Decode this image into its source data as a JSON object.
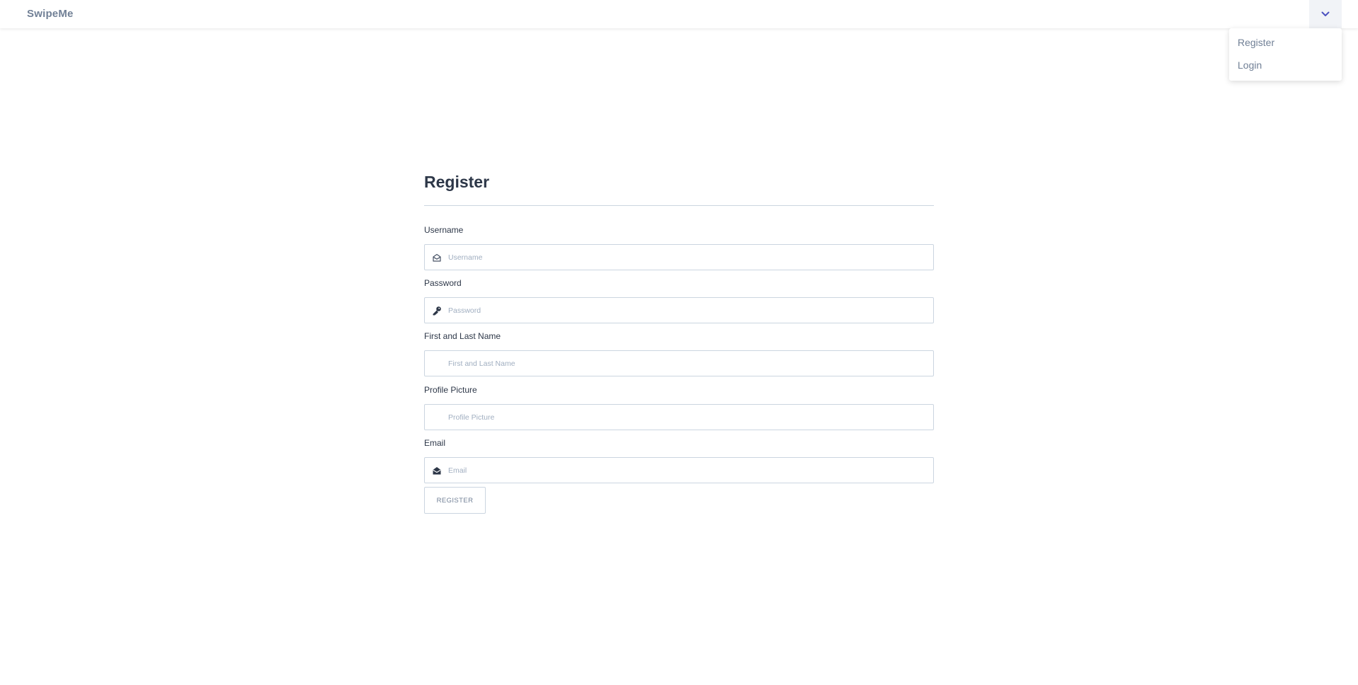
{
  "navbar": {
    "brand": "SwipeMe",
    "menu_items": [
      {
        "label": "Register"
      },
      {
        "label": "Login"
      }
    ]
  },
  "form": {
    "title": "Register",
    "fields": [
      {
        "label": "Username",
        "placeholder": "Username",
        "value": "",
        "icon": "envelope-open-icon"
      },
      {
        "label": "Password",
        "placeholder": "Password",
        "value": "",
        "icon": "key-icon"
      },
      {
        "label": "First and Last Name",
        "placeholder": "First and Last Name",
        "value": "",
        "icon": ""
      },
      {
        "label": "Profile Picture",
        "placeholder": "Profile Picture",
        "value": "",
        "icon": ""
      },
      {
        "label": "Email",
        "placeholder": "Email",
        "value": "",
        "icon": "envelope-solid-icon"
      }
    ],
    "submit_label": "REGISTER"
  },
  "colors": {
    "text_dark": "#2d3748",
    "text_muted": "#718096",
    "border": "#cbd5e0",
    "accent_chevron": "#4c51bf"
  }
}
